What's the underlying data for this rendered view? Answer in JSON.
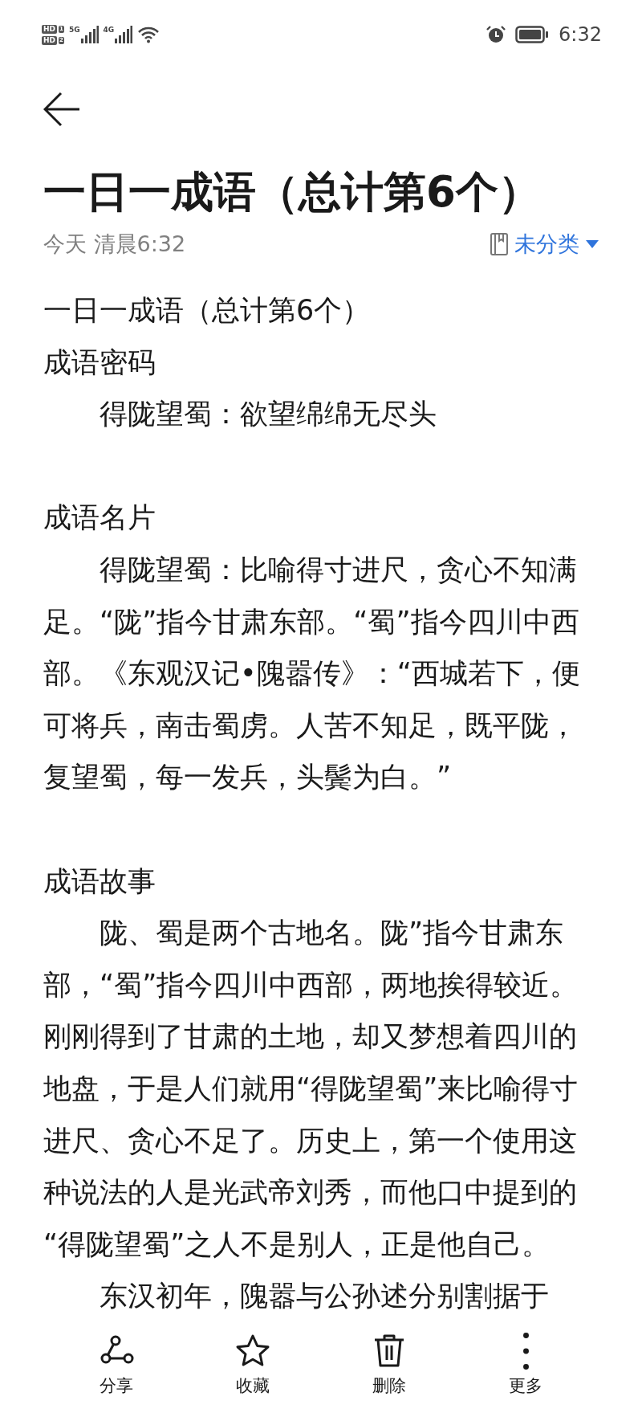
{
  "status_bar": {
    "sims": [
      {
        "badge": "HD",
        "slot": "1"
      },
      {
        "badge": "HD",
        "slot": "2"
      }
    ],
    "networks": [
      {
        "label": "5G"
      },
      {
        "label": "4G"
      }
    ],
    "time": "6:32"
  },
  "note": {
    "title": "一日一成语（总计第6个）",
    "date": "今天 清晨6:32",
    "category": "未分类",
    "blocks": [
      {
        "kind": "line",
        "indent": false,
        "lines": [
          "一日一成语（总计第6个）"
        ]
      },
      {
        "kind": "line",
        "indent": false,
        "lines": [
          "成语密码"
        ]
      },
      {
        "kind": "line",
        "indent": true,
        "lines": [
          "得陇望蜀：欲望绵绵无尽头"
        ]
      },
      {
        "kind": "blank"
      },
      {
        "kind": "line",
        "indent": false,
        "lines": [
          "成语名片"
        ]
      },
      {
        "kind": "line",
        "indent": true,
        "lines": [
          "得陇望蜀：比喻得寸进尺，贪心不知满",
          "足。“陇”指今甘肃东部。“蜀”指今四川中西",
          "部。《东观汉记•隗嚣传》：“西城若下，便",
          "可将兵，南击蜀虏。人苦不知足，既平陇，",
          "复望蜀，每一发兵，头鬓为白。”"
        ]
      },
      {
        "kind": "blank"
      },
      {
        "kind": "line",
        "indent": false,
        "lines": [
          "成语故事"
        ]
      },
      {
        "kind": "line",
        "indent": true,
        "lines": [
          "陇、蜀是两个古地名。陇”指今甘肃东",
          "部，“蜀”指今四川中西部，两地挨得较近。",
          "刚刚得到了甘肃的土地，却又梦想着四川的",
          "地盘，于是人们就用“得陇望蜀”来比喻得寸",
          "进尺、贪心不足了。历史上，第一个使用这",
          "种说法的人是光武帝刘秀，而他口中提到的",
          "“得陇望蜀”之人不是别人，正是他自己。"
        ]
      },
      {
        "kind": "line",
        "indent": true,
        "lines": [
          "东汉初年，隗嚣与公孙述分别割据于"
        ]
      }
    ]
  },
  "toolbar": [
    {
      "kind": "share",
      "label": "分享"
    },
    {
      "kind": "star",
      "label": "收藏"
    },
    {
      "kind": "trash",
      "label": "删除"
    },
    {
      "kind": "more",
      "label": "更多"
    }
  ]
}
